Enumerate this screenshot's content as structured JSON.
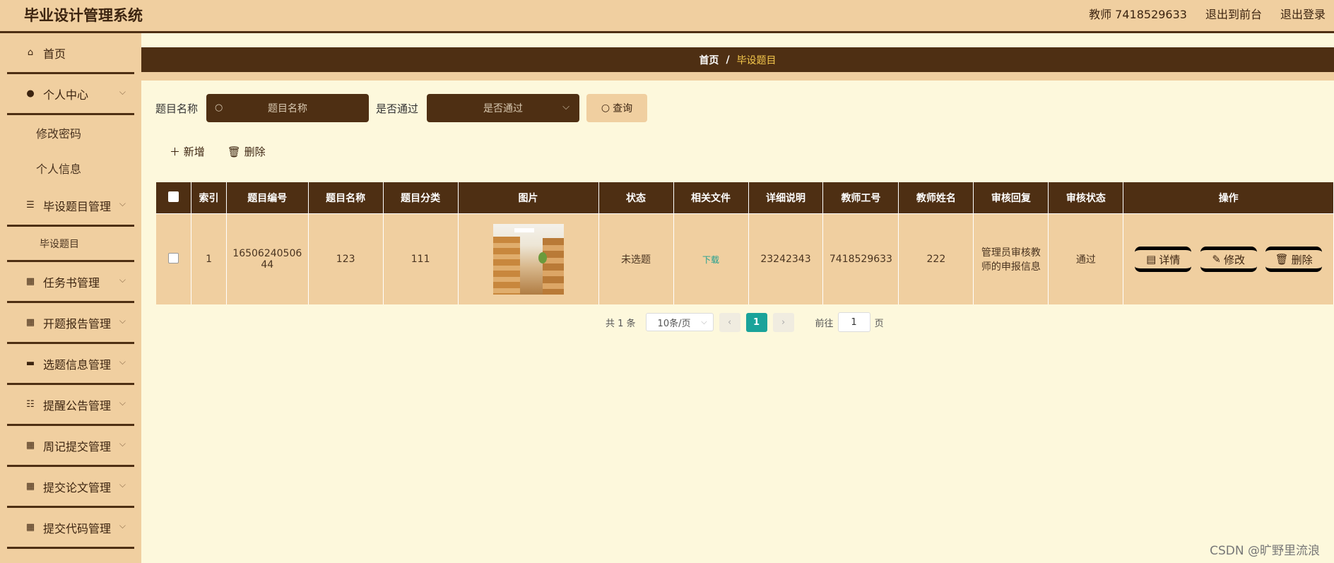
{
  "header": {
    "title": "毕业设计管理系统",
    "user": "教师 7418529633",
    "front": "退出到前台",
    "logout": "退出登录"
  },
  "sidebar": {
    "home": "首页",
    "personal": "个人中心",
    "change_password": "修改密码",
    "personal_info": "个人信息",
    "topic_mgmt": "毕设题目管理",
    "topic": "毕设题目",
    "task_mgmt": "任务书管理",
    "opening_mgmt": "开题报告管理",
    "selection_mgmt": "选题信息管理",
    "notice_mgmt": "提醒公告管理",
    "weekly_mgmt": "周记提交管理",
    "thesis_mgmt": "提交论文管理",
    "code_mgmt": "提交代码管理"
  },
  "breadcrumb": {
    "home": "首页",
    "sep": "/",
    "current": "毕设题目"
  },
  "search": {
    "name_label": "题目名称",
    "name_placeholder": "题目名称",
    "pass_label": "是否通过",
    "pass_placeholder": "是否通过",
    "query_label": "查询"
  },
  "actions": {
    "add": "新增",
    "delete": "删除"
  },
  "table": {
    "headers": [
      "索引",
      "题目编号",
      "题目名称",
      "题目分类",
      "图片",
      "状态",
      "相关文件",
      "详细说明",
      "教师工号",
      "教师姓名",
      "审核回复",
      "审核状态",
      "操作"
    ],
    "rows": [
      {
        "index": "1",
        "code": "1650624050644",
        "name": "123",
        "category": "111",
        "status": "未选题",
        "file": "下载",
        "detail": "23242343",
        "teacher_id": "7418529633",
        "teacher_name": "222",
        "reply": "管理员审核教师的申报信息",
        "audit": "通过"
      }
    ],
    "ops": {
      "detail": "详情",
      "edit": "修改",
      "delete": "删除"
    }
  },
  "pager": {
    "total": "共 1 条",
    "size": "10条/页",
    "current": "1",
    "goto_label": "前往",
    "goto_value": "1",
    "page_unit": "页"
  },
  "watermark": "CSDN @旷野里流浪"
}
